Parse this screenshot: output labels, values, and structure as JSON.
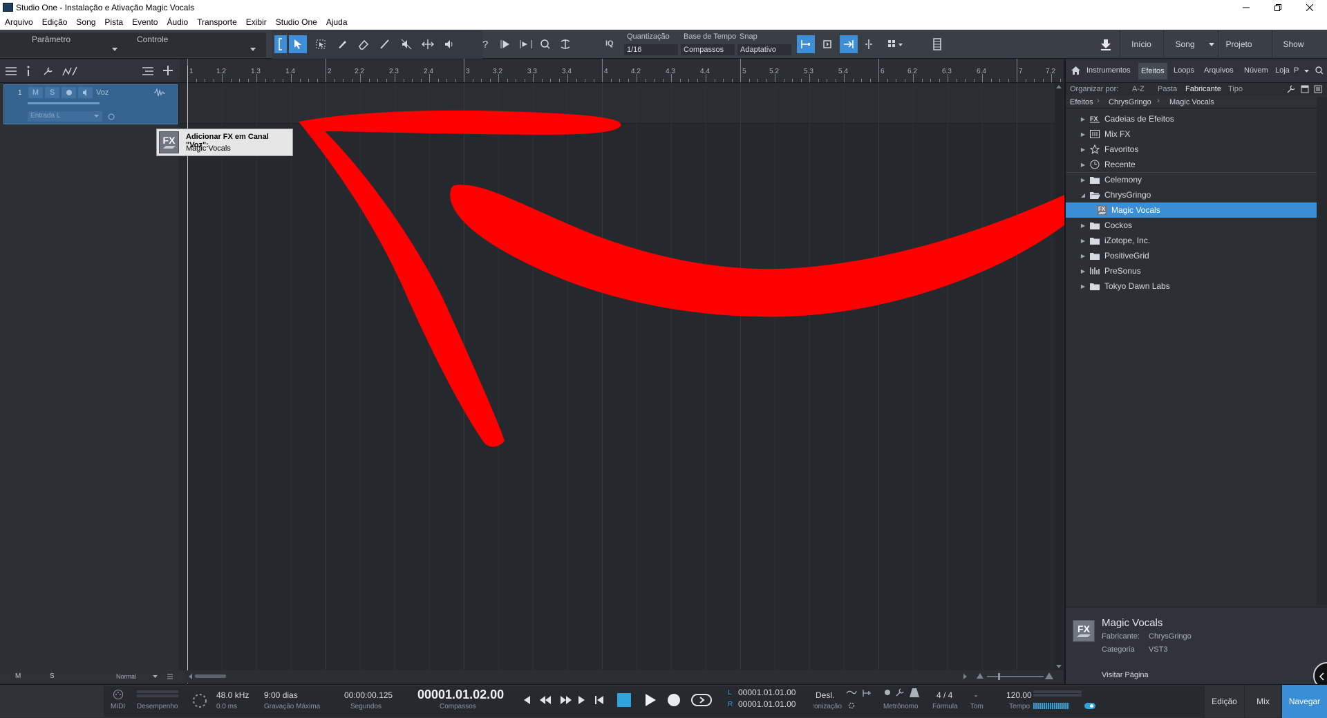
{
  "window": {
    "title": "Studio One - Instalação e Ativação Magic Vocals"
  },
  "menu": [
    "Arquivo",
    "Edição",
    "Song",
    "Pista",
    "Evento",
    "Áudio",
    "Transporte",
    "Exibir",
    "Studio One",
    "Ajuda"
  ],
  "toolbar": {
    "parametro": "Parâmetro",
    "controle": "Controle",
    "iq": "IQ",
    "quantizacao_label": "Quantização",
    "quantizacao_value": "1/16",
    "base_tempo_label": "Base de Tempo",
    "base_tempo_value": "Compassos",
    "snap_label": "Snap",
    "snap_value": "Adaptativo",
    "nav": {
      "inicio": "Início",
      "song": "Song",
      "projeto": "Projeto",
      "show": "Show"
    }
  },
  "ruler": [
    "1",
    "1.2",
    "1.3",
    "1.4",
    "2",
    "2.2",
    "2.3",
    "2.4",
    "3",
    "3.2",
    "3.3",
    "3.4",
    "4",
    "4.2",
    "4.3",
    "4.4",
    "5",
    "5.2",
    "5.3",
    "5.4",
    "6",
    "6.2",
    "6.3",
    "6.4",
    "7",
    "7.2"
  ],
  "track": {
    "number": "1",
    "mute": "M",
    "solo": "S",
    "name": "Voz",
    "input": "Entrada L"
  },
  "tooltip": {
    "title": "Adicionar FX em Canal \"Voz\":",
    "item": "Magic Vocals",
    "badge": "FX"
  },
  "left_footer": {
    "m": "M",
    "s": "S",
    "mode": "Normal"
  },
  "browser": {
    "tabs": [
      "Instrumentos",
      "Efeitos",
      "Loops",
      "Arquivos",
      "Núvem",
      "Loja",
      "P"
    ],
    "active_tab": "Efeitos",
    "sort": {
      "label": "Organizar por:",
      "options": [
        "A-Z",
        "Pasta",
        "Fabricante",
        "Tipo"
      ],
      "active": "Fabricante"
    },
    "breadcrumb": [
      "Efeitos",
      "ChrysGringo",
      "Magic Vocals"
    ],
    "items": [
      {
        "label": "Cadeias de Efeitos",
        "icon": "fx-chain-icon"
      },
      {
        "label": "Mix FX",
        "icon": "mixfx-icon"
      },
      {
        "label": "Favoritos",
        "icon": "star-icon"
      },
      {
        "label": "Recente",
        "icon": "clock-icon"
      },
      {
        "label": "Celemony",
        "icon": "folder-icon"
      },
      {
        "label": "ChrysGringo",
        "icon": "folder-open-icon",
        "expanded": true
      },
      {
        "label": "Magic Vocals",
        "icon": "fx-plugin-icon",
        "selected": true,
        "child": true
      },
      {
        "label": "Cockos",
        "icon": "folder-icon"
      },
      {
        "label": "iZotope, Inc.",
        "icon": "folder-icon"
      },
      {
        "label": "PositiveGrid",
        "icon": "folder-icon"
      },
      {
        "label": "PreSonus",
        "icon": "presonus-icon"
      },
      {
        "label": "Tokyo Dawn Labs",
        "icon": "folder-icon"
      }
    ],
    "info": {
      "name": "Magic Vocals",
      "fabricante_label": "Fabricante:",
      "fabricante": "ChrysGringo",
      "categoria_label": "Categoria",
      "categoria": "VST3",
      "link": "Visitar Página",
      "badge": "FX"
    }
  },
  "transport": {
    "midi": "MIDI",
    "desempenho": "Desempenho",
    "samplerate": "48.0 kHz",
    "latency": "0.0 ms",
    "record_time": "9:00 dias",
    "record_label": "Gravação Máxima",
    "seconds": "00:00:00.125",
    "seconds_label": "Segundos",
    "position": "00001.01.02.00",
    "position_label": "Compassos",
    "loop_l_tag": "L",
    "loop_r_tag": "R",
    "loop_l": "00001.01.01.00",
    "loop_r": "00001.01.01.00",
    "sync": "Desl.",
    "sync_label": "Sincronização",
    "metronome_label": "Metrônomo",
    "signature": "4 / 4",
    "signature_label": "Fórmula",
    "key": "-",
    "key_label": "Tom",
    "tempo": "120.00",
    "tempo_label": "Tempo",
    "nav": {
      "edicao": "Edição",
      "mix": "Mix",
      "navegar": "Navegar"
    }
  },
  "colors": {
    "accent": "#3a8ed6",
    "annotation": "#ff0000",
    "background": "#26292e"
  }
}
